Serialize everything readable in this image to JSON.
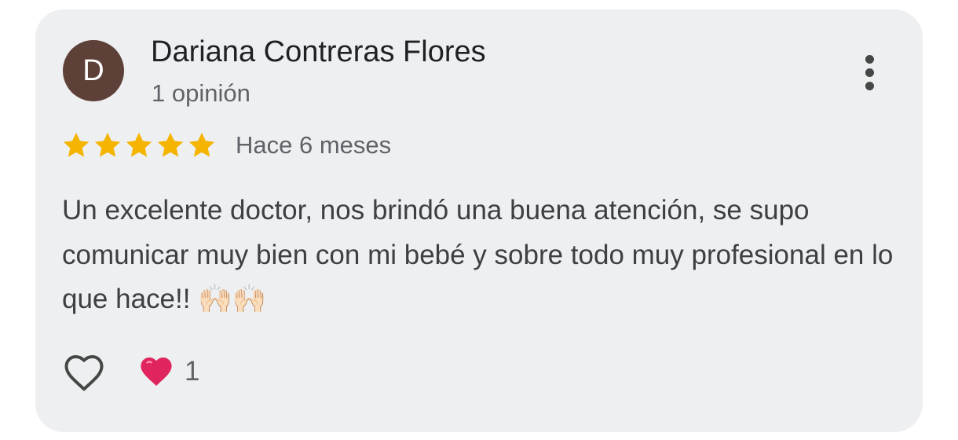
{
  "review": {
    "avatar_initial": "D",
    "author_name": "Dariana Contreras Flores",
    "author_meta": "1 opinión",
    "rating": 5,
    "rating_max": 5,
    "time": "Hace 6 meses",
    "text": "Un excelente doctor, nos brindó una buena atención, se supo comunicar muy bien con mi bebé y sobre todo muy profesional en lo que hace!! 🙌🏻🙌🏻",
    "reaction_count": "1"
  },
  "icons": {
    "more": "more-vert-icon",
    "star": "star-icon",
    "like": "heart-outline-icon",
    "reaction": "red-heart-icon"
  },
  "colors": {
    "card_background": "#eeeff1",
    "avatar_background": "#5d4037",
    "star": "#f4b400",
    "heart": "#e0245e"
  }
}
